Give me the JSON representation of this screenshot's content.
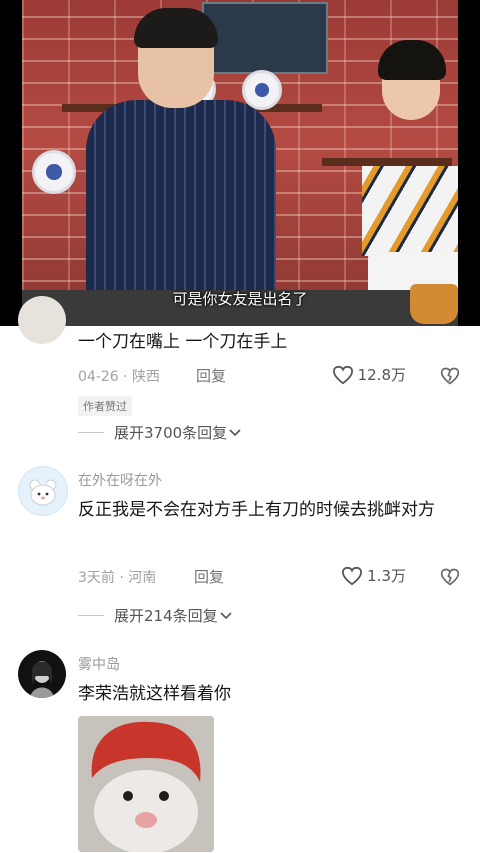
{
  "video": {
    "subtitle": "可是你女友是出名了"
  },
  "comments": [
    {
      "text": "一个刀在嘴上 一个刀在手上",
      "date": "04-26",
      "location": "陕西",
      "reply_label": "回复",
      "likes": "12.8万",
      "badge": "作者赞过",
      "expand": "展开3700条回复"
    },
    {
      "username": "在外在呀在外",
      "text": "反正我是不会在对方手上有刀的时候去挑衅对方",
      "date": "3天前",
      "location": "河南",
      "reply_label": "回复",
      "likes": "1.3万",
      "expand": "展开214条回复"
    },
    {
      "username": "雾中岛",
      "text": "李荣浩就这样看着你"
    }
  ],
  "icons": {
    "like": "heart-outline-icon",
    "dislike": "broken-heart-icon",
    "expand": "chevron-down-icon"
  }
}
